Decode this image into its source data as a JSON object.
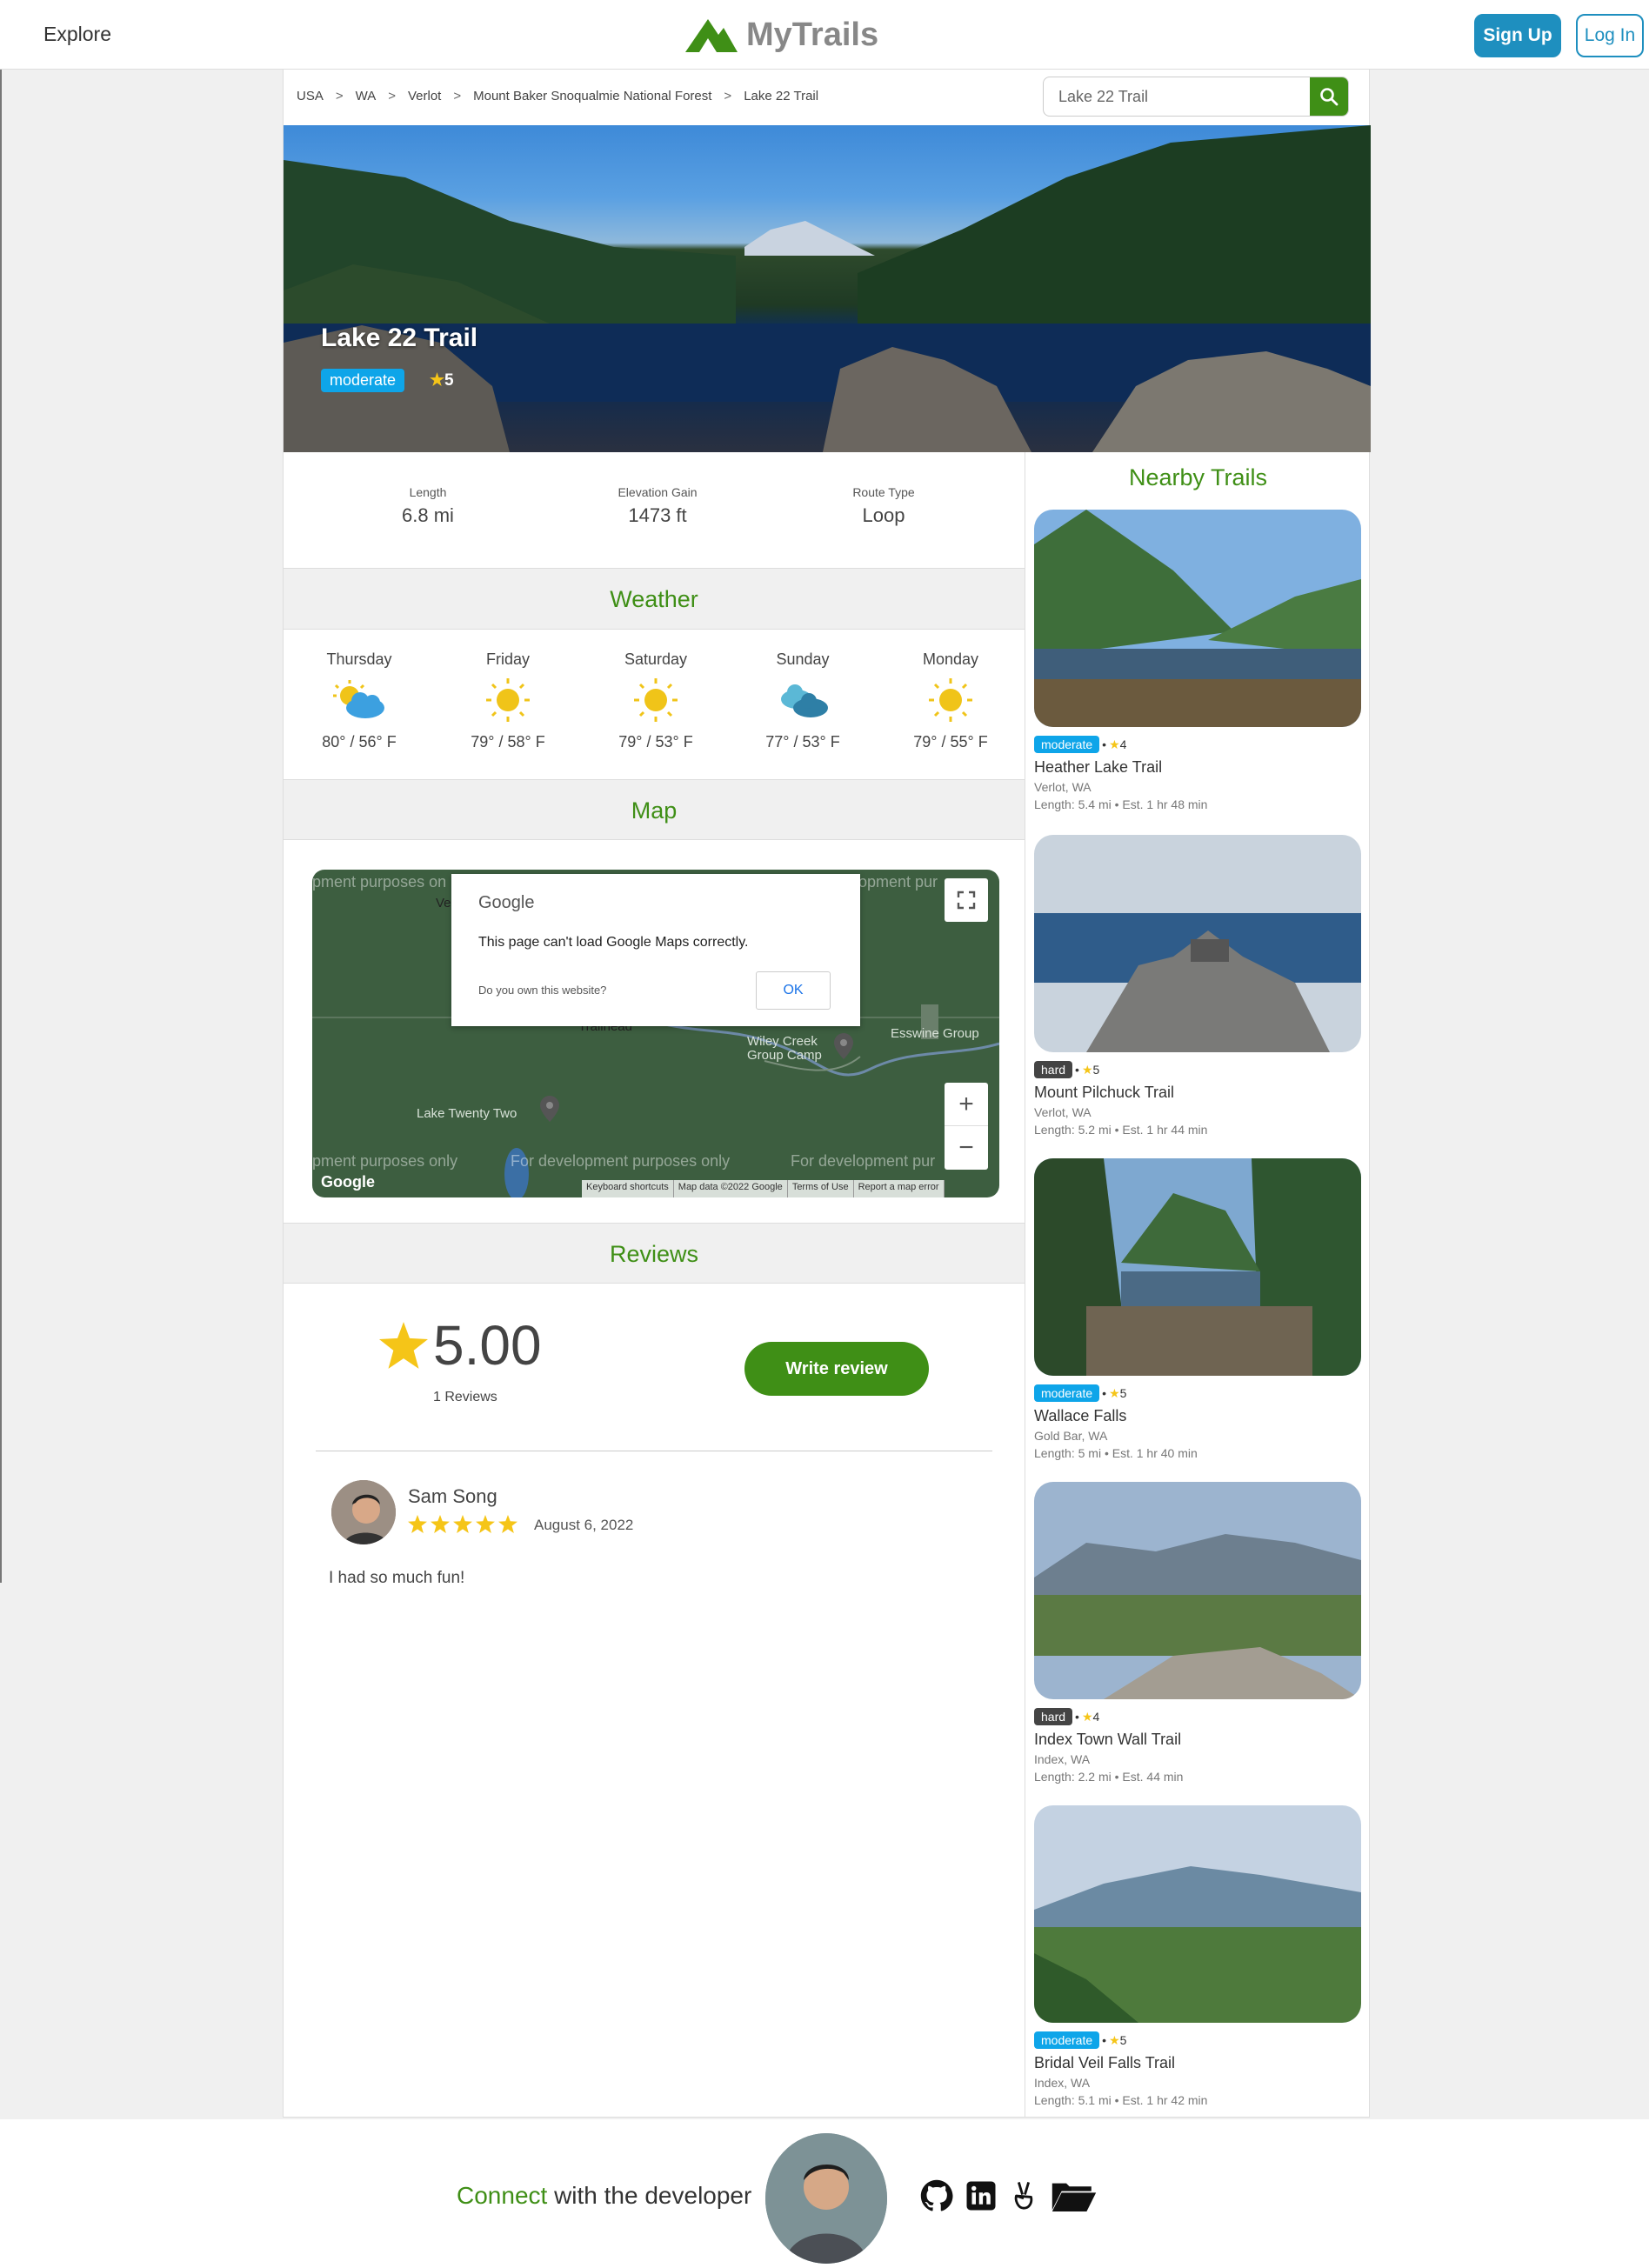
{
  "nav": {
    "explore": "Explore",
    "brand": "MyTrails",
    "signup": "Sign Up",
    "login": "Log In"
  },
  "breadcrumb": [
    "USA",
    "WA",
    "Verlot",
    "Mount Baker Snoqualmie National Forest",
    "Lake 22 Trail"
  ],
  "search": {
    "value": "Lake 22 Trail"
  },
  "trail": {
    "title": "Lake 22 Trail",
    "difficulty": "moderate",
    "rating": "5",
    "length_label": "Length",
    "length": "6.8 mi",
    "elevation_label": "Elevation Gain",
    "elevation": "1473 ft",
    "route_label": "Route Type",
    "route": "Loop"
  },
  "weather": {
    "heading": "Weather",
    "days": [
      {
        "day": "Thursday",
        "temps": "80° / 56° F",
        "icon": "partly-cloudy-icon"
      },
      {
        "day": "Friday",
        "temps": "79° / 58° F",
        "icon": "sun-icon"
      },
      {
        "day": "Saturday",
        "temps": "79° / 53° F",
        "icon": "sun-icon"
      },
      {
        "day": "Sunday",
        "temps": "77° / 53° F",
        "icon": "cloudy-icon"
      },
      {
        "day": "Monday",
        "temps": "79° / 55° F",
        "icon": "sun-icon"
      }
    ]
  },
  "map": {
    "heading": "Map",
    "dev_text": "For development purposes only",
    "dev_partial_tl": "pment purposes on",
    "dev_partial_tr": "opment pur",
    "dev_partial_bl": "pment purposes only",
    "dev_partial_br": "For development pur",
    "dialog_brand": "Google",
    "dialog_message": "This page can't load Google Maps correctly.",
    "dialog_question": "Do you own this website?",
    "dialog_ok": "OK",
    "labels": {
      "ve": "Ve",
      "trailhead": "Trailhead",
      "camp": "Wiley Creek Group Camp",
      "esswine": "Esswine Group",
      "lake": "Lake Twenty Two"
    },
    "zoom_in": "+",
    "zoom_out": "−",
    "attribution": [
      "Keyboard shortcuts",
      "Map data ©2022 Google",
      "Terms of Use",
      "Report a map error"
    ],
    "google_logo": "Google"
  },
  "reviews": {
    "heading": "Reviews",
    "average": "5.00",
    "count": "1 Reviews",
    "write": "Write review",
    "items": [
      {
        "name": "Sam Song",
        "date": "August 6, 2022",
        "stars": 5,
        "text": "I had so much fun!"
      }
    ]
  },
  "nearby": {
    "heading": "Nearby Trails",
    "cards": [
      {
        "difficulty": "moderate",
        "rating": "4",
        "name": "Heather Lake Trail",
        "location": "Verlot, WA",
        "length": "Length: 5.4 mi • Est. 1 hr 48 min"
      },
      {
        "difficulty": "hard",
        "rating": "5",
        "name": "Mount Pilchuck Trail",
        "location": "Verlot, WA",
        "length": "Length: 5.2 mi • Est. 1 hr 44 min"
      },
      {
        "difficulty": "moderate",
        "rating": "5",
        "name": "Wallace Falls",
        "location": "Gold Bar, WA",
        "length": "Length: 5 mi • Est. 1 hr 40 min"
      },
      {
        "difficulty": "hard",
        "rating": "4",
        "name": "Index Town Wall Trail",
        "location": "Index, WA",
        "length": "Length: 2.2 mi • Est. 44 min"
      },
      {
        "difficulty": "moderate",
        "rating": "5",
        "name": "Bridal Veil Falls Trail",
        "location": "Index, WA",
        "length": "Length: 5.1 mi • Est. 1 hr 42 min"
      }
    ]
  },
  "footer": {
    "connect": "Connect",
    "rest": " with the developer",
    "icons": [
      "github-icon",
      "linkedin-icon",
      "angellist-icon",
      "folder-icon"
    ]
  },
  "colors": {
    "green": "#3f8f16",
    "blue": "#1e8fbf",
    "moderate": "#0ea5e9",
    "hard": "#444444"
  }
}
